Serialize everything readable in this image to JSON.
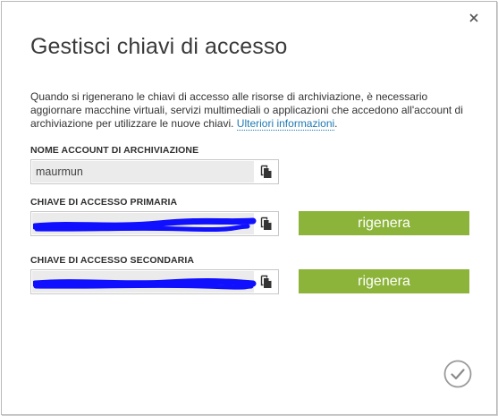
{
  "dialog": {
    "title": "Gestisci chiavi di accesso",
    "description": "Quando si rigenerano le chiavi di accesso alle risorse di archiviazione, è necessario aggiornare macchine virtuali, servizi multimediali o applicazioni che accedono all'account di archiviazione per utilizzare le nuove chiavi. ",
    "more_info_link": "Ulteriori informazioni",
    "description_end": "."
  },
  "account": {
    "label": "NOME ACCOUNT DI ARCHIVIAZIONE",
    "value": "maurmun"
  },
  "primary_key": {
    "label": "CHIAVE DI ACCESSO PRIMARIA",
    "regenerate_label": "rigenera"
  },
  "secondary_key": {
    "label": "CHIAVE DI ACCESSO SECONDARIA",
    "regenerate_label": "rigenera"
  },
  "icons": {
    "close": "close-icon",
    "copy": "copy-icon",
    "confirm": "checkmark-circle-icon"
  },
  "colors": {
    "button_green": "#8cb43a",
    "link_blue": "#1e7ab3",
    "redaction_blue": "#1010ff"
  }
}
